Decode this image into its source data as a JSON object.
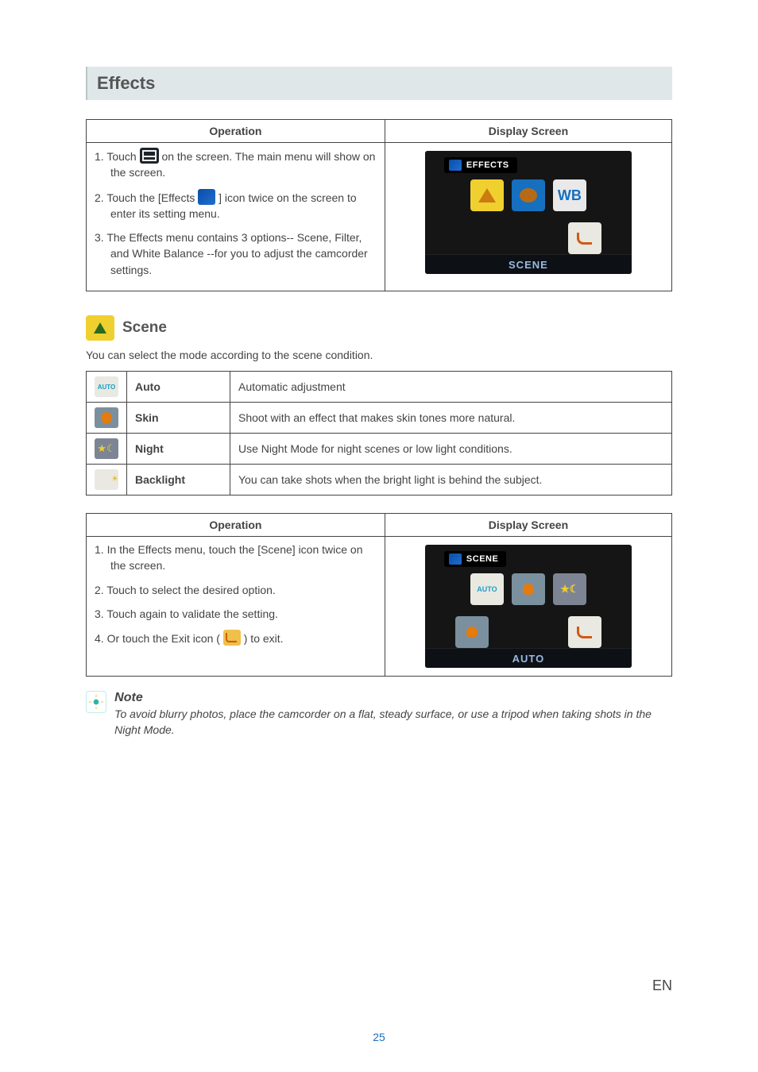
{
  "heading": "Effects",
  "table1": {
    "col_operation": "Operation",
    "col_display": "Display Screen",
    "step1_a": "1.  Touch ",
    "step1_b": " on the screen. The main menu will show on the screen.",
    "step2_a": "2.  Touch the [Effects ",
    "step2_b": " ] icon twice on the screen to enter its setting menu.",
    "step3": "3.  The Effects menu contains 3 options-- Scene, Filter, and White Balance --for you to adjust the camcorder settings."
  },
  "screen1": {
    "title": "EFFECTS",
    "wb": "WB",
    "bottom": "SCENE"
  },
  "scene_heading": "Scene",
  "scene_intro": "You can select the mode according to the scene condition.",
  "modes": [
    {
      "name": "Auto",
      "desc": "Automatic adjustment"
    },
    {
      "name": "Skin",
      "desc": "Shoot with an effect that makes skin tones more natural."
    },
    {
      "name": "Night",
      "desc": "Use Night Mode for night scenes or low light conditions."
    },
    {
      "name": "Backlight",
      "desc": "You can take shots when the bright light is behind the subject."
    }
  ],
  "table2": {
    "col_operation": "Operation",
    "col_display": "Display Screen",
    "step1": "1.  In the Effects menu, touch the [Scene] icon twice on the screen.",
    "step2": "2.  Touch to select the desired option.",
    "step3": "3.  Touch again to validate the setting.",
    "step4_a": "4.  Or touch the Exit icon ( ",
    "step4_b": " ) to exit."
  },
  "screen2": {
    "title": "SCENE",
    "bottom": "AUTO"
  },
  "note": {
    "title": "Note",
    "body": "To avoid blurry photos, place the camcorder on a flat, steady surface, or use a tripod when taking shots in the Night Mode."
  },
  "footer": {
    "page": "25",
    "lang": "EN"
  }
}
